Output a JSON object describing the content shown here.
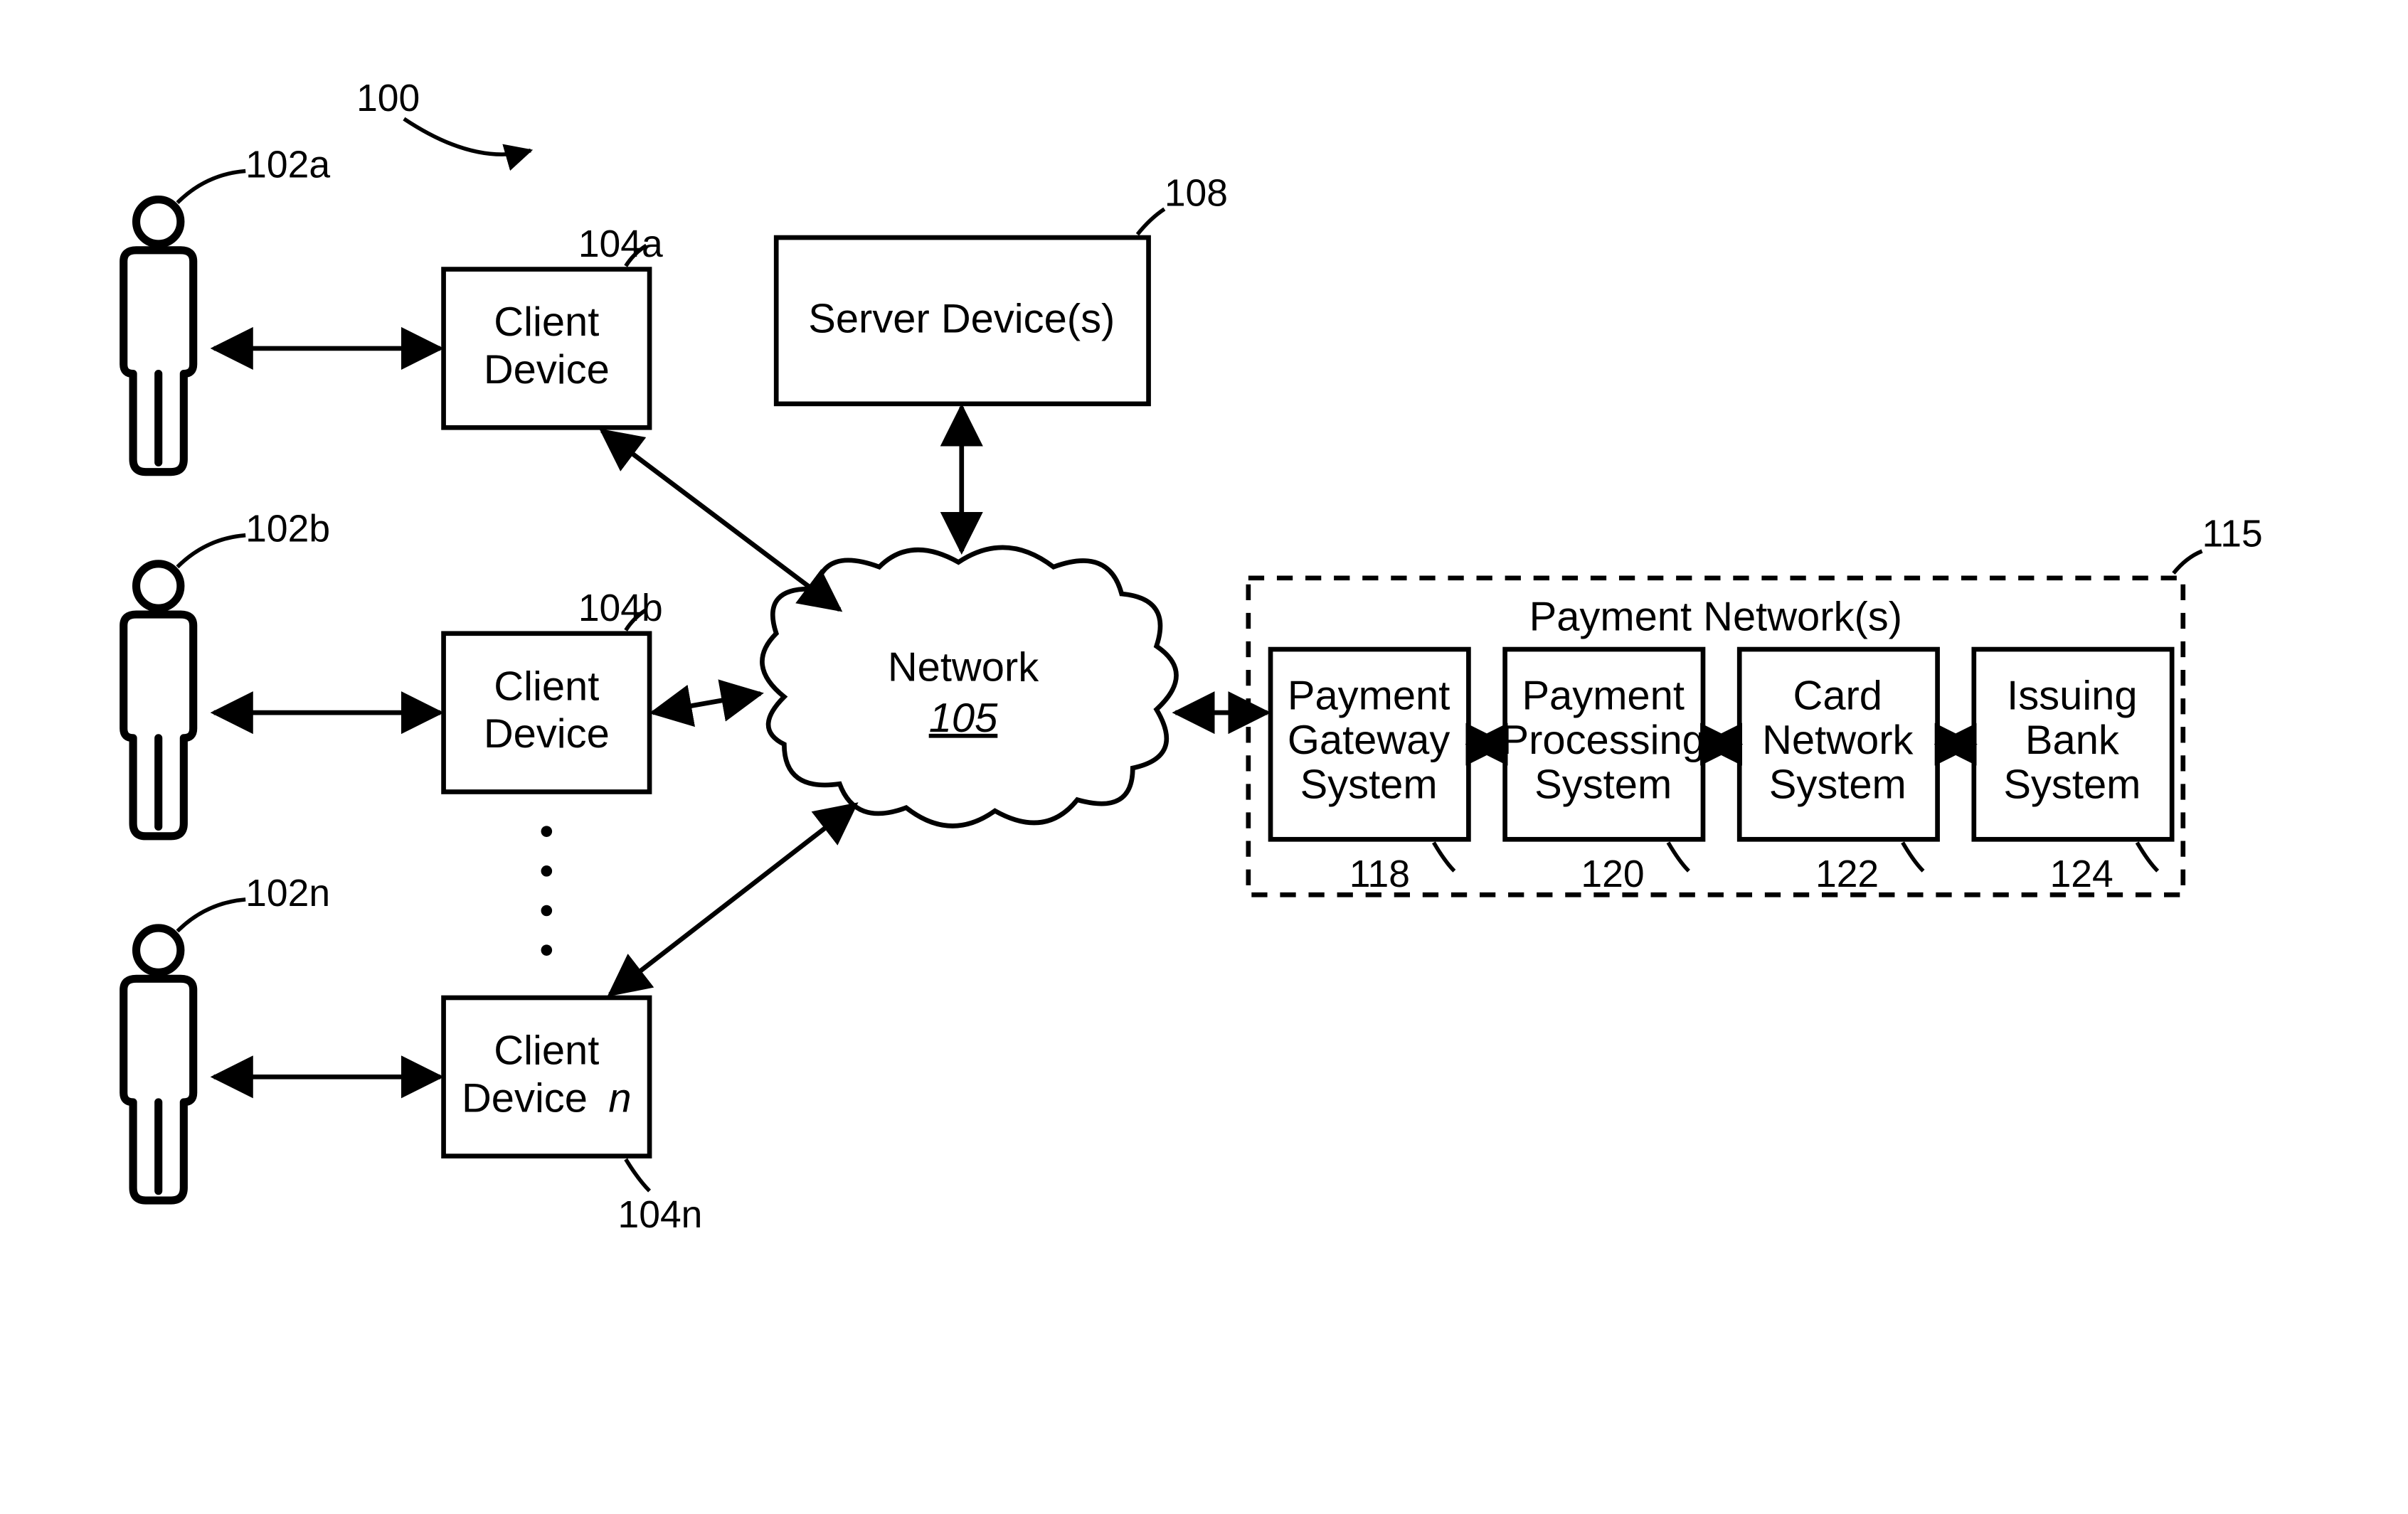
{
  "figure_ref": "100",
  "users": [
    {
      "ref": "102a"
    },
    {
      "ref": "102b"
    },
    {
      "ref": "102n"
    }
  ],
  "client_devices": [
    {
      "ref": "104a",
      "line1": "Client",
      "line2": "Device"
    },
    {
      "ref": "104b",
      "line1": "Client",
      "line2": "Device"
    },
    {
      "ref": "104n",
      "line1": "Client",
      "line2": "Device",
      "line2_suffix": "n"
    }
  ],
  "server": {
    "ref": "108",
    "label": "Server Device(s)"
  },
  "network": {
    "ref": "105",
    "line1": "Network"
  },
  "payment_network": {
    "ref": "115",
    "title": "Payment Network(s)",
    "nodes": [
      {
        "ref": "118",
        "line1": "Payment",
        "line2": "Gateway",
        "line3": "System"
      },
      {
        "ref": "120",
        "line1": "Payment",
        "line2": "Processing",
        "line3": "System"
      },
      {
        "ref": "122",
        "line1": "Card",
        "line2": "Network",
        "line3": "System"
      },
      {
        "ref": "124",
        "line1": "Issuing",
        "line2": "Bank",
        "line3": "System"
      }
    ]
  }
}
